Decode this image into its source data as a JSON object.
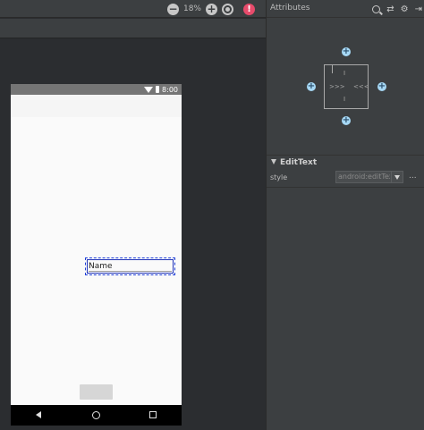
{
  "toolbar": {
    "zoom_out": "−",
    "zoom_level": "18%",
    "zoom_in": "+",
    "warning": "!"
  },
  "phone": {
    "status_time": "8:00",
    "edittext_text": "Name"
  },
  "attributes": {
    "title": "Attributes",
    "tools": {
      "swap": "⇄",
      "settings": "⚙",
      "menu_caret": "▾",
      "collapse": "⇥"
    },
    "constraint": {
      "plus": "+",
      "top_margin": "I",
      "bottom_margin": "I",
      "left_marker": ">>>",
      "right_marker": "<<<"
    },
    "section": {
      "title": "EditText"
    },
    "rows": [
      {
        "name": "style",
        "value": "android:editTex",
        "more": "..."
      }
    ]
  },
  "colors": {
    "canvas_bg": "#2b2d30",
    "panel_bg": "#3c3f41",
    "selection_blue": "#1f3fd8",
    "plus_blue": "#a6d8f5",
    "warning_red": "#e74b6b"
  },
  "icons": [
    "zoom-out-icon",
    "zoom-in-icon",
    "zoom-sync-icon",
    "warning-icon",
    "search-icon",
    "swap-icon",
    "settings-icon",
    "collapse-icon",
    "wifi-icon",
    "battery-icon",
    "back-icon",
    "home-icon",
    "recents-icon"
  ]
}
